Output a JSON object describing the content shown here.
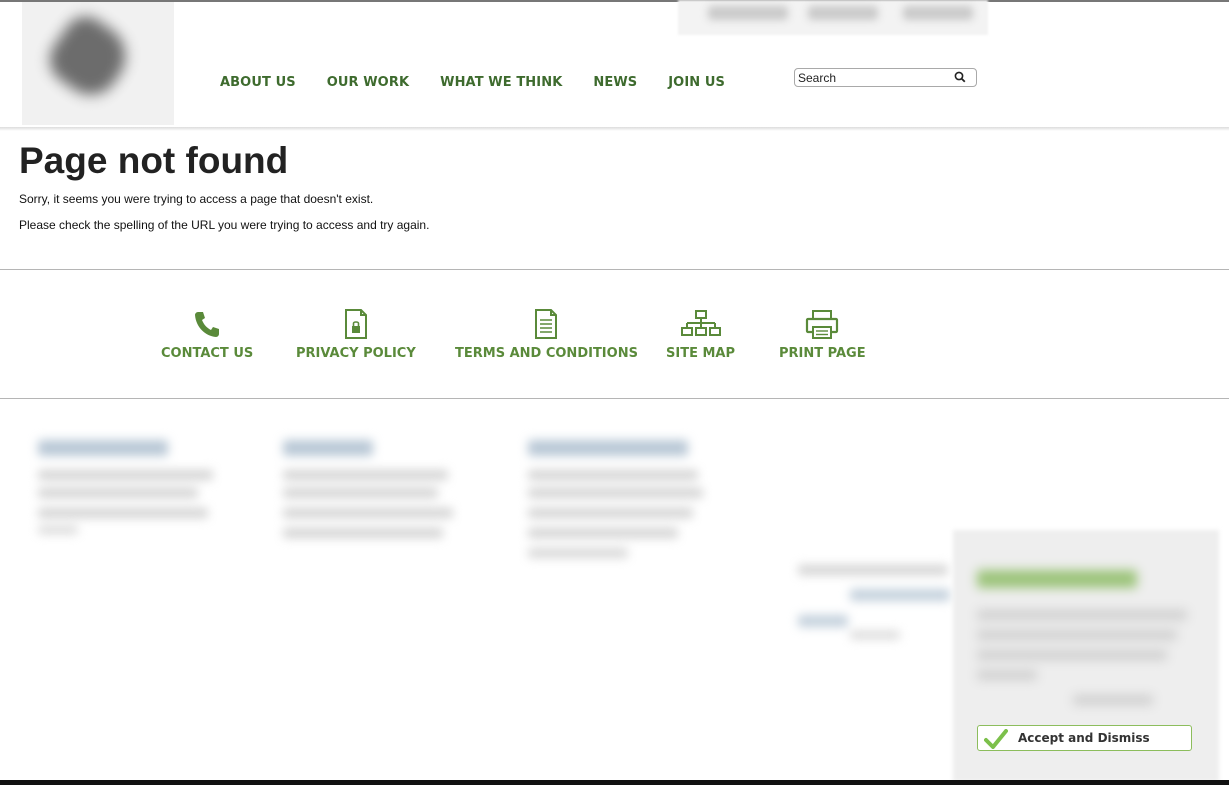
{
  "header": {
    "nav": [
      "ABOUT US",
      "OUR WORK",
      "WHAT WE THINK",
      "NEWS",
      "JOIN US"
    ],
    "search_placeholder": "Search"
  },
  "main": {
    "title": "Page not found",
    "message_1": "Sorry, it seems you were trying to access a page that doesn't exist.",
    "message_2": "Please check the spelling of the URL you were trying to access and try again."
  },
  "footer_links": [
    {
      "label": "CONTACT US",
      "icon": "phone-icon"
    },
    {
      "label": "PRIVACY POLICY",
      "icon": "lock-document-icon"
    },
    {
      "label": "TERMS AND CONDITIONS",
      "icon": "document-icon"
    },
    {
      "label": "SITE MAP",
      "icon": "sitemap-icon"
    },
    {
      "label": "PRINT PAGE",
      "icon": "printer-icon"
    }
  ],
  "cookie_banner": {
    "accept_label": "Accept and Dismiss"
  },
  "colors": {
    "nav_green": "#3e6b2e",
    "link_green": "#5a8a3a",
    "check_green": "#7cc04b"
  }
}
